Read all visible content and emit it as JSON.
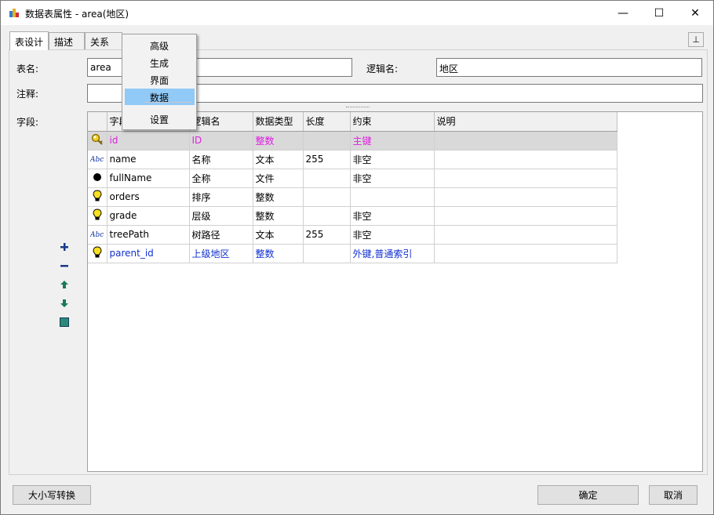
{
  "window": {
    "title": "数据表属性 - area(地区)",
    "minimize": "—",
    "maximize": "☐",
    "close": "✕"
  },
  "tabs": [
    {
      "label": "表设计"
    },
    {
      "label": "描述"
    },
    {
      "label": "关系"
    }
  ],
  "pin_label": "⊥",
  "form": {
    "table_name_label": "表名:",
    "table_name_value": "area",
    "logic_name_label": "逻辑名:",
    "logic_name_value": "地区",
    "comment_label": "注释:",
    "comment_value": "",
    "fields_label": "字段:"
  },
  "grid": {
    "columns": [
      "",
      "字段名",
      "逻辑名",
      "数据类型",
      "长度",
      "约束",
      "说明"
    ],
    "rows": [
      {
        "icon": "key-icon",
        "name": "id",
        "logic": "ID",
        "type": "整数",
        "length": "",
        "constraint": "主键",
        "desc": "",
        "style": "pink"
      },
      {
        "icon": "abc-icon",
        "name": "name",
        "logic": "名称",
        "type": "文本",
        "length": "255",
        "constraint": "非空",
        "desc": "",
        "style": "normal"
      },
      {
        "icon": "dot-icon",
        "name": "fullName",
        "logic": "全称",
        "type": "文件",
        "length": "",
        "constraint": "非空",
        "desc": "",
        "style": "normal"
      },
      {
        "icon": "bulb-icon",
        "name": "orders",
        "logic": "排序",
        "type": "整数",
        "length": "",
        "constraint": "",
        "desc": "",
        "style": "normal"
      },
      {
        "icon": "bulb-icon",
        "name": "grade",
        "logic": "层级",
        "type": "整数",
        "length": "",
        "constraint": "非空",
        "desc": "",
        "style": "normal"
      },
      {
        "icon": "abc-icon",
        "name": "treePath",
        "logic": "树路径",
        "type": "文本",
        "length": "255",
        "constraint": "非空",
        "desc": "",
        "style": "normal"
      },
      {
        "icon": "bulb-icon",
        "name": "parent_id",
        "logic": "上级地区",
        "type": "整数",
        "length": "",
        "constraint": "外键,普通索引",
        "desc": "",
        "style": "blue"
      }
    ]
  },
  "menu": {
    "items": [
      "高级",
      "生成",
      "界面",
      "数据",
      "设置"
    ],
    "highlighted": "数据"
  },
  "buttons": {
    "case_convert": "大小写转换",
    "ok": "确定",
    "cancel": "取消"
  },
  "colors": {
    "pink": "#e020e0",
    "blue": "#1030d0",
    "menu_highlight": "#91c9f7",
    "selected_row": "#d9d9d9"
  }
}
